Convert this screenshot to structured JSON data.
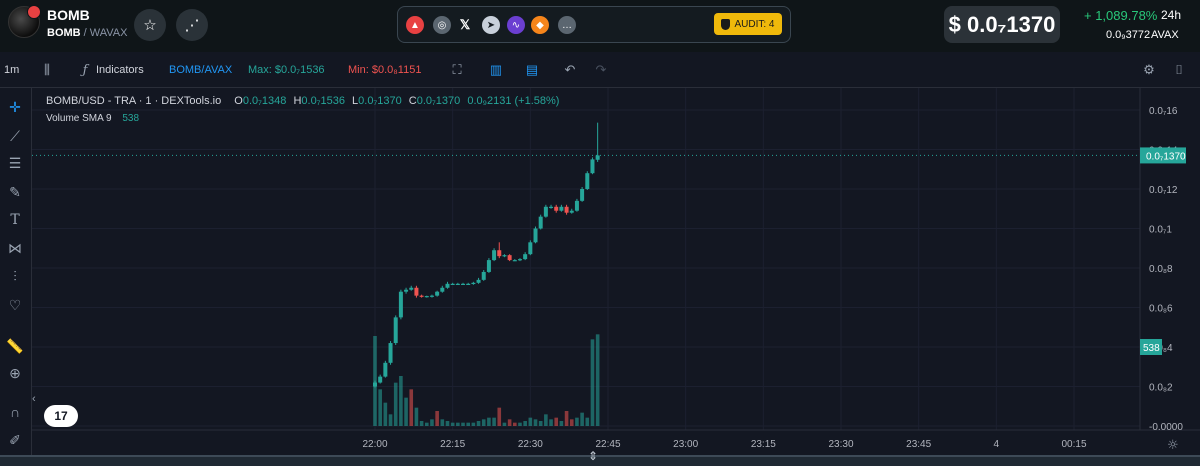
{
  "header": {
    "token_name": "BOMB",
    "pair_base": "BOMB",
    "pair_sep": " / ",
    "pair_quote": "WAVAX",
    "social_icons": [
      "avalanche-icon",
      "globe-icon",
      "x-icon",
      "telegram-icon",
      "dapp-icon",
      "metamask-icon",
      "more-icon"
    ],
    "audit_label": "AUDIT: 4",
    "price": "$ 0.0₇1370",
    "change_pct": "+ 1,089.78%",
    "change_period": "24h",
    "avax_price": "0.0₉3772",
    "avax_label": "AVAX",
    "colors": {
      "accent_green": "#29c77a",
      "audit_yellow": "#f0b90b"
    }
  },
  "toolbar": {
    "timeframe": "1m",
    "indicators_label": "Indicators",
    "pair_label": "BOMB/AVAX",
    "max_label": "Max: $0.0₇1536",
    "min_label": "Min: $0.0₈1151"
  },
  "legend": {
    "title": "BOMB/USD - TRA · 1 · DEXTools.io",
    "o_key": "O",
    "o_val": "0.0₇1348",
    "h_key": "H",
    "h_val": "0.0₇1536",
    "l_key": "L",
    "l_val": "0.0₇1370",
    "c_key": "C",
    "c_val": "0.0₇1370",
    "change": "0.0₉2131 (+1.58%)",
    "volume_label": "Volume SMA 9",
    "volume_value": "538"
  },
  "chart_data": {
    "type": "candlestick",
    "y_ticks": [
      "0.0₇16",
      "0.0₇14",
      "0.0₇12",
      "0.0₇1",
      "0.0₈8",
      "0.0₈6",
      "0.0₈4",
      "0.0₈2",
      "-0.0000"
    ],
    "x_ticks": [
      "22:00",
      "22:15",
      "22:30",
      "22:45",
      "23:00",
      "23:15",
      "23:30",
      "23:45",
      "4",
      "00:15"
    ],
    "current_price_label": "0.0₇1370",
    "volume_label": "538",
    "colors": {
      "up": "#26a69a",
      "down": "#ef5350"
    },
    "candles": [
      {
        "t": "22:00",
        "o": 2.0,
        "h": 2.3,
        "l": 1.95,
        "c": 2.2
      },
      {
        "t": "22:01",
        "o": 2.2,
        "h": 2.6,
        "l": 2.15,
        "c": 2.5
      },
      {
        "t": "22:02",
        "o": 2.5,
        "h": 3.3,
        "l": 2.45,
        "c": 3.2
      },
      {
        "t": "22:03",
        "o": 3.2,
        "h": 4.3,
        "l": 3.1,
        "c": 4.2
      },
      {
        "t": "22:04",
        "o": 4.2,
        "h": 5.6,
        "l": 4.1,
        "c": 5.5
      },
      {
        "t": "22:05",
        "o": 5.5,
        "h": 6.9,
        "l": 5.4,
        "c": 6.8
      },
      {
        "t": "22:06",
        "o": 6.8,
        "h": 7.0,
        "l": 6.7,
        "c": 6.9
      },
      {
        "t": "22:07",
        "o": 6.9,
        "h": 7.1,
        "l": 6.85,
        "c": 7.0
      },
      {
        "t": "22:08",
        "o": 7.0,
        "h": 7.1,
        "l": 6.5,
        "c": 6.6
      },
      {
        "t": "22:09",
        "o": 6.6,
        "h": 6.65,
        "l": 6.5,
        "c": 6.55
      },
      {
        "t": "22:10",
        "o": 6.55,
        "h": 6.6,
        "l": 6.5,
        "c": 6.58
      },
      {
        "t": "22:11",
        "o": 6.58,
        "h": 6.65,
        "l": 6.5,
        "c": 6.6
      },
      {
        "t": "22:12",
        "o": 6.6,
        "h": 6.85,
        "l": 6.55,
        "c": 6.8
      },
      {
        "t": "22:13",
        "o": 6.8,
        "h": 7.1,
        "l": 6.75,
        "c": 7.0
      },
      {
        "t": "22:14",
        "o": 7.0,
        "h": 7.3,
        "l": 6.95,
        "c": 7.2
      },
      {
        "t": "22:15",
        "o": 7.2,
        "h": 7.25,
        "l": 7.15,
        "c": 7.2
      },
      {
        "t": "22:16",
        "o": 7.2,
        "h": 7.25,
        "l": 7.15,
        "c": 7.2
      },
      {
        "t": "22:17",
        "o": 7.2,
        "h": 7.25,
        "l": 7.15,
        "c": 7.2
      },
      {
        "t": "22:18",
        "o": 7.2,
        "h": 7.25,
        "l": 7.15,
        "c": 7.2
      },
      {
        "t": "22:19",
        "o": 7.2,
        "h": 7.3,
        "l": 7.15,
        "c": 7.25
      },
      {
        "t": "22:20",
        "o": 7.25,
        "h": 7.5,
        "l": 7.2,
        "c": 7.4
      },
      {
        "t": "22:21",
        "o": 7.4,
        "h": 7.9,
        "l": 7.35,
        "c": 7.8
      },
      {
        "t": "22:22",
        "o": 7.8,
        "h": 8.5,
        "l": 7.75,
        "c": 8.4
      },
      {
        "t": "22:23",
        "o": 8.4,
        "h": 9.0,
        "l": 8.35,
        "c": 8.9
      },
      {
        "t": "22:24",
        "o": 8.9,
        "h": 9.3,
        "l": 8.5,
        "c": 8.6
      },
      {
        "t": "22:25",
        "o": 8.6,
        "h": 8.7,
        "l": 8.55,
        "c": 8.65
      },
      {
        "t": "22:26",
        "o": 8.65,
        "h": 8.7,
        "l": 8.35,
        "c": 8.4
      },
      {
        "t": "22:27",
        "o": 8.4,
        "h": 8.45,
        "l": 8.35,
        "c": 8.4
      },
      {
        "t": "22:28",
        "o": 8.4,
        "h": 8.5,
        "l": 8.35,
        "c": 8.45
      },
      {
        "t": "22:29",
        "o": 8.45,
        "h": 8.8,
        "l": 8.4,
        "c": 8.7
      },
      {
        "t": "22:30",
        "o": 8.7,
        "h": 9.4,
        "l": 8.65,
        "c": 9.3
      },
      {
        "t": "22:31",
        "o": 9.3,
        "h": 10.1,
        "l": 9.25,
        "c": 10.0
      },
      {
        "t": "22:32",
        "o": 10.0,
        "h": 10.7,
        "l": 9.95,
        "c": 10.6
      },
      {
        "t": "22:33",
        "o": 10.6,
        "h": 11.2,
        "l": 10.55,
        "c": 11.1
      },
      {
        "t": "22:34",
        "o": 11.1,
        "h": 11.2,
        "l": 11.0,
        "c": 11.1
      },
      {
        "t": "22:35",
        "o": 11.1,
        "h": 11.2,
        "l": 10.8,
        "c": 10.9
      },
      {
        "t": "22:36",
        "o": 10.9,
        "h": 11.2,
        "l": 10.85,
        "c": 11.1
      },
      {
        "t": "22:37",
        "o": 11.1,
        "h": 11.2,
        "l": 10.7,
        "c": 10.8
      },
      {
        "t": "22:38",
        "o": 10.8,
        "h": 11.0,
        "l": 10.75,
        "c": 10.9
      },
      {
        "t": "22:39",
        "o": 10.9,
        "h": 11.5,
        "l": 10.85,
        "c": 11.4
      },
      {
        "t": "22:40",
        "o": 11.4,
        "h": 12.1,
        "l": 11.35,
        "c": 12.0
      },
      {
        "t": "22:41",
        "o": 12.0,
        "h": 12.9,
        "l": 11.95,
        "c": 12.8
      },
      {
        "t": "22:42",
        "o": 12.8,
        "h": 13.6,
        "l": 12.75,
        "c": 13.5
      },
      {
        "t": "22:43",
        "o": 13.48,
        "h": 15.36,
        "l": 13.37,
        "c": 13.7
      }
    ],
    "volumes": [
      {
        "t": "22:00",
        "v": 270,
        "up": true
      },
      {
        "t": "22:01",
        "v": 110,
        "up": true
      },
      {
        "t": "22:02",
        "v": 70,
        "up": true
      },
      {
        "t": "22:03",
        "v": 35,
        "up": true
      },
      {
        "t": "22:04",
        "v": 130,
        "up": true
      },
      {
        "t": "22:05",
        "v": 150,
        "up": true
      },
      {
        "t": "22:06",
        "v": 85,
        "up": true
      },
      {
        "t": "22:07",
        "v": 110,
        "up": false
      },
      {
        "t": "22:08",
        "v": 55,
        "up": true
      },
      {
        "t": "22:09",
        "v": 15,
        "up": true
      },
      {
        "t": "22:10",
        "v": 10,
        "up": true
      },
      {
        "t": "22:11",
        "v": 20,
        "up": true
      },
      {
        "t": "22:12",
        "v": 45,
        "up": false
      },
      {
        "t": "22:13",
        "v": 20,
        "up": true
      },
      {
        "t": "22:14",
        "v": 15,
        "up": true
      },
      {
        "t": "22:15",
        "v": 10,
        "up": true
      },
      {
        "t": "22:16",
        "v": 10,
        "up": true
      },
      {
        "t": "22:17",
        "v": 10,
        "up": true
      },
      {
        "t": "22:18",
        "v": 10,
        "up": true
      },
      {
        "t": "22:19",
        "v": 10,
        "up": true
      },
      {
        "t": "22:20",
        "v": 15,
        "up": true
      },
      {
        "t": "22:21",
        "v": 20,
        "up": true
      },
      {
        "t": "22:22",
        "v": 25,
        "up": true
      },
      {
        "t": "22:23",
        "v": 25,
        "up": true
      },
      {
        "t": "22:24",
        "v": 55,
        "up": false
      },
      {
        "t": "22:25",
        "v": 10,
        "up": true
      },
      {
        "t": "22:26",
        "v": 20,
        "up": false
      },
      {
        "t": "22:27",
        "v": 10,
        "up": false
      },
      {
        "t": "22:28",
        "v": 10,
        "up": true
      },
      {
        "t": "22:29",
        "v": 15,
        "up": true
      },
      {
        "t": "22:30",
        "v": 25,
        "up": true
      },
      {
        "t": "22:31",
        "v": 20,
        "up": true
      },
      {
        "t": "22:32",
        "v": 15,
        "up": true
      },
      {
        "t": "22:33",
        "v": 35,
        "up": true
      },
      {
        "t": "22:34",
        "v": 20,
        "up": true
      },
      {
        "t": "22:35",
        "v": 25,
        "up": false
      },
      {
        "t": "22:36",
        "v": 15,
        "up": true
      },
      {
        "t": "22:37",
        "v": 45,
        "up": false
      },
      {
        "t": "22:38",
        "v": 20,
        "up": false
      },
      {
        "t": "22:39",
        "v": 25,
        "up": true
      },
      {
        "t": "22:40",
        "v": 40,
        "up": true
      },
      {
        "t": "22:41",
        "v": 25,
        "up": true
      },
      {
        "t": "22:42",
        "v": 260,
        "up": true
      },
      {
        "t": "22:43",
        "v": 275,
        "up": true
      }
    ]
  }
}
